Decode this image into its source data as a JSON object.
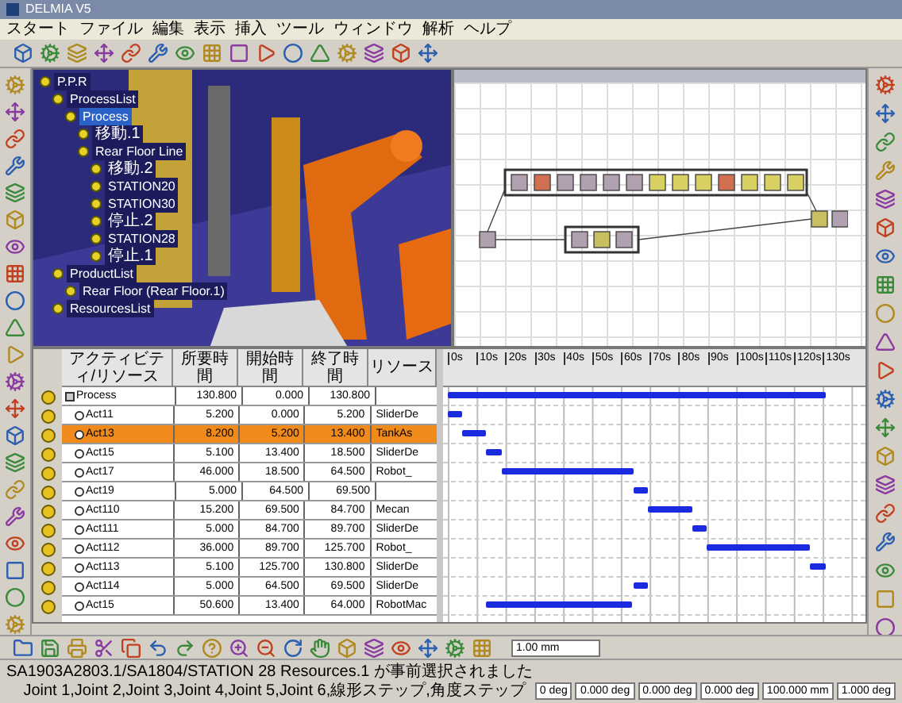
{
  "window": {
    "title": "DELMIA V5"
  },
  "menu": [
    "スタート",
    "ファイル",
    "編集",
    "表示",
    "挿入",
    "ツール",
    "ウィンドウ",
    "解析",
    "ヘルプ"
  ],
  "tree": [
    {
      "label": "P.P.R",
      "children": [
        {
          "label": "ProcessList",
          "children": [
            {
              "label": "Process",
              "selected": true,
              "children": [
                {
                  "label": "移動.1",
                  "selected": false
                },
                {
                  "label": "Rear Floor Line",
                  "selected": false,
                  "children": [
                    {
                      "label": "移動.2",
                      "selected": false
                    },
                    {
                      "label": "STATION20",
                      "selected": false
                    },
                    {
                      "label": "STATION30",
                      "selected": false
                    },
                    {
                      "label": "停止.2",
                      "selected": false
                    },
                    {
                      "label": "STATION28",
                      "selected": false
                    },
                    {
                      "label": "停止.1",
                      "selected": false
                    }
                  ]
                }
              ]
            }
          ]
        },
        {
          "label": "ProductList",
          "children": [
            {
              "label": "Rear Floor (Rear Floor.1)",
              "selected": false
            }
          ]
        },
        {
          "label": "ResourcesList",
          "selected": false
        }
      ]
    }
  ],
  "gantt": {
    "columns": [
      "アクティビティ/リソース",
      "所要時間",
      "開始時間",
      "終了時間",
      "リソース"
    ],
    "rows": [
      {
        "name": "Process",
        "duration": "130.800",
        "start": "0.000",
        "end": "130.800",
        "resource": "",
        "selected": false,
        "kind": "root"
      },
      {
        "name": "Act11",
        "duration": "5.200",
        "start": "0.000",
        "end": "5.200",
        "resource": "SliderDe",
        "selected": false,
        "kind": "child"
      },
      {
        "name": "Act13",
        "duration": "8.200",
        "start": "5.200",
        "end": "13.400",
        "resource": "TankAs",
        "selected": true,
        "kind": "child"
      },
      {
        "name": "Act15",
        "duration": "5.100",
        "start": "13.400",
        "end": "18.500",
        "resource": "SliderDe",
        "selected": false,
        "kind": "child"
      },
      {
        "name": "Act17",
        "duration": "46.000",
        "start": "18.500",
        "end": "64.500",
        "resource": "Robot_",
        "selected": false,
        "kind": "child"
      },
      {
        "name": "Act19",
        "duration": "5.000",
        "start": "64.500",
        "end": "69.500",
        "resource": "",
        "selected": false,
        "kind": "child"
      },
      {
        "name": "Act110",
        "duration": "15.200",
        "start": "69.500",
        "end": "84.700",
        "resource": "Mecan",
        "selected": false,
        "kind": "child"
      },
      {
        "name": "Act111",
        "duration": "5.000",
        "start": "84.700",
        "end": "89.700",
        "resource": "SliderDe",
        "selected": false,
        "kind": "child"
      },
      {
        "name": "Act112",
        "duration": "36.000",
        "start": "89.700",
        "end": "125.700",
        "resource": "Robot_",
        "selected": false,
        "kind": "child"
      },
      {
        "name": "Act113",
        "duration": "5.100",
        "start": "125.700",
        "end": "130.800",
        "resource": "SliderDe",
        "selected": false,
        "kind": "child"
      },
      {
        "name": "Act114",
        "duration": "5.000",
        "start": "64.500",
        "end": "69.500",
        "resource": "SliderDe",
        "selected": false,
        "kind": "child"
      },
      {
        "name": "Act15",
        "duration": "50.600",
        "start": "13.400",
        "end": "64.000",
        "resource": "RobotMac",
        "selected": false,
        "kind": "child"
      }
    ],
    "ticks": [
      "0s",
      "10s",
      "20s",
      "30s",
      "40s",
      "50s",
      "60s",
      "70s",
      "80s",
      "90s",
      "100s",
      "110s",
      "120s",
      "130s"
    ]
  },
  "step_field": {
    "value": "1.00 mm"
  },
  "status_bar": {
    "message": "SA1903A2803.1/SA1804/STATION 28 Resources.1 が事前選択されました",
    "joints": "Joint 1,Joint 2,Joint 3,Joint 4,Joint 5,Joint 6,線形ステップ,角度ステップ",
    "fields": [
      "0 deg",
      "0.000 deg",
      "0.000 deg",
      "0.000 deg",
      "100.000 mm",
      "1.000 deg"
    ]
  }
}
